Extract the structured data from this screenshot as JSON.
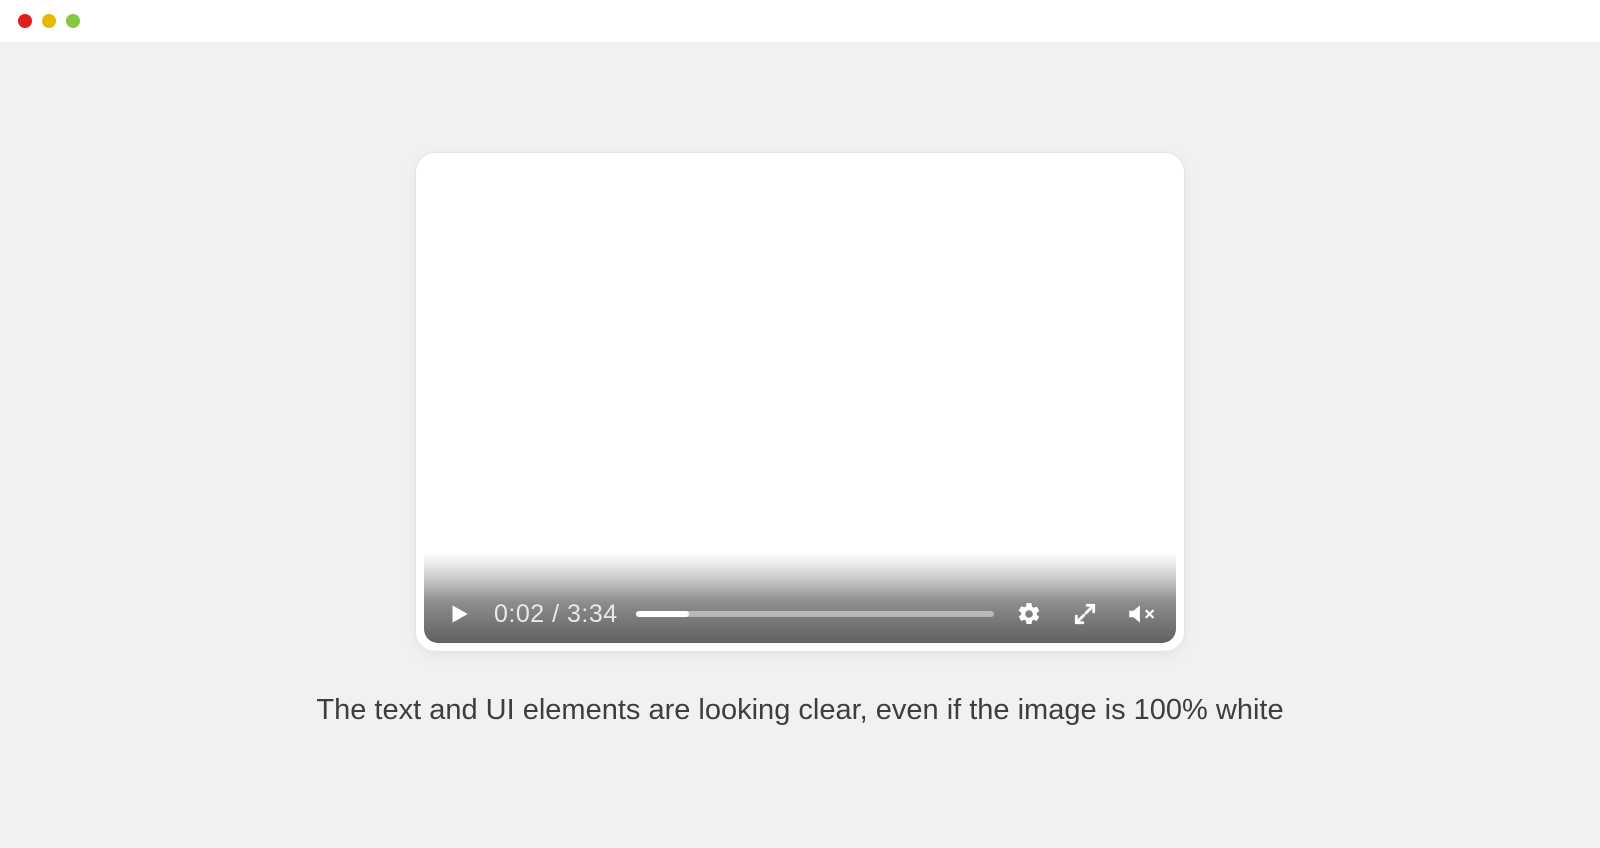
{
  "window": {
    "traffic_lights": {
      "close": "close",
      "minimize": "minimize",
      "maximize": "maximize"
    }
  },
  "player": {
    "current_time": "0:02",
    "separator": " / ",
    "duration": "3:34",
    "progress_percent": 15,
    "icons": {
      "play": "play-icon",
      "settings": "gear-icon",
      "fullscreen": "fullscreen-icon",
      "mute": "volume-muted-icon"
    }
  },
  "caption": "The text and UI elements are looking clear, even if the image is 100% white"
}
